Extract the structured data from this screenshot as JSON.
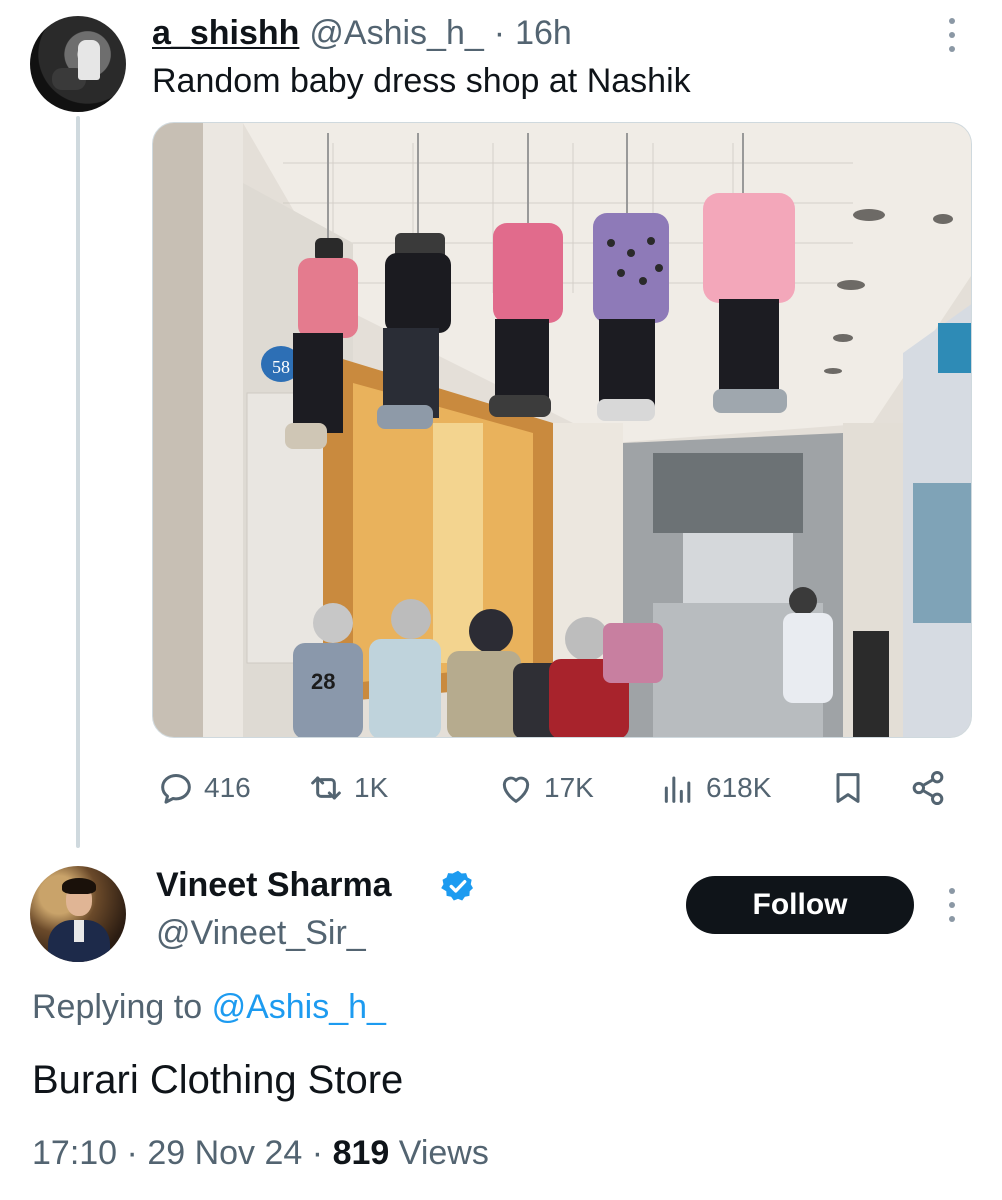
{
  "original_tweet": {
    "display_name": "a_shishh",
    "handle": "@Ashis_h_",
    "separator": "·",
    "time_ago": "16h",
    "text": "Random baby dress shop at Nashik",
    "media": {
      "storefront_number": "58",
      "mannequin_jersey_number": "28"
    },
    "actions": {
      "replies": "416",
      "reposts": "1K",
      "likes": "17K",
      "views": "618K"
    }
  },
  "reply_tweet": {
    "display_name": "Vineet Sharma",
    "handle": "@Vineet_Sir_",
    "verified": true,
    "follow_label": "Follow",
    "replying_prefix": "Replying to",
    "replying_to": "@Ashis_h_",
    "text": "Burari Clothing Store",
    "time": "17:10",
    "separator": "·",
    "date": "29 Nov 24",
    "views_count": "819",
    "views_label": "Views"
  },
  "colors": {
    "accent": "#1d9bf0",
    "text_primary": "#0f1419",
    "text_secondary": "#536471",
    "follow_button_bg": "#0f1419"
  },
  "icons": [
    "reply-icon",
    "repost-icon",
    "like-icon",
    "views-icon",
    "bookmark-icon",
    "share-icon",
    "more-icon",
    "verified-badge-icon"
  ]
}
